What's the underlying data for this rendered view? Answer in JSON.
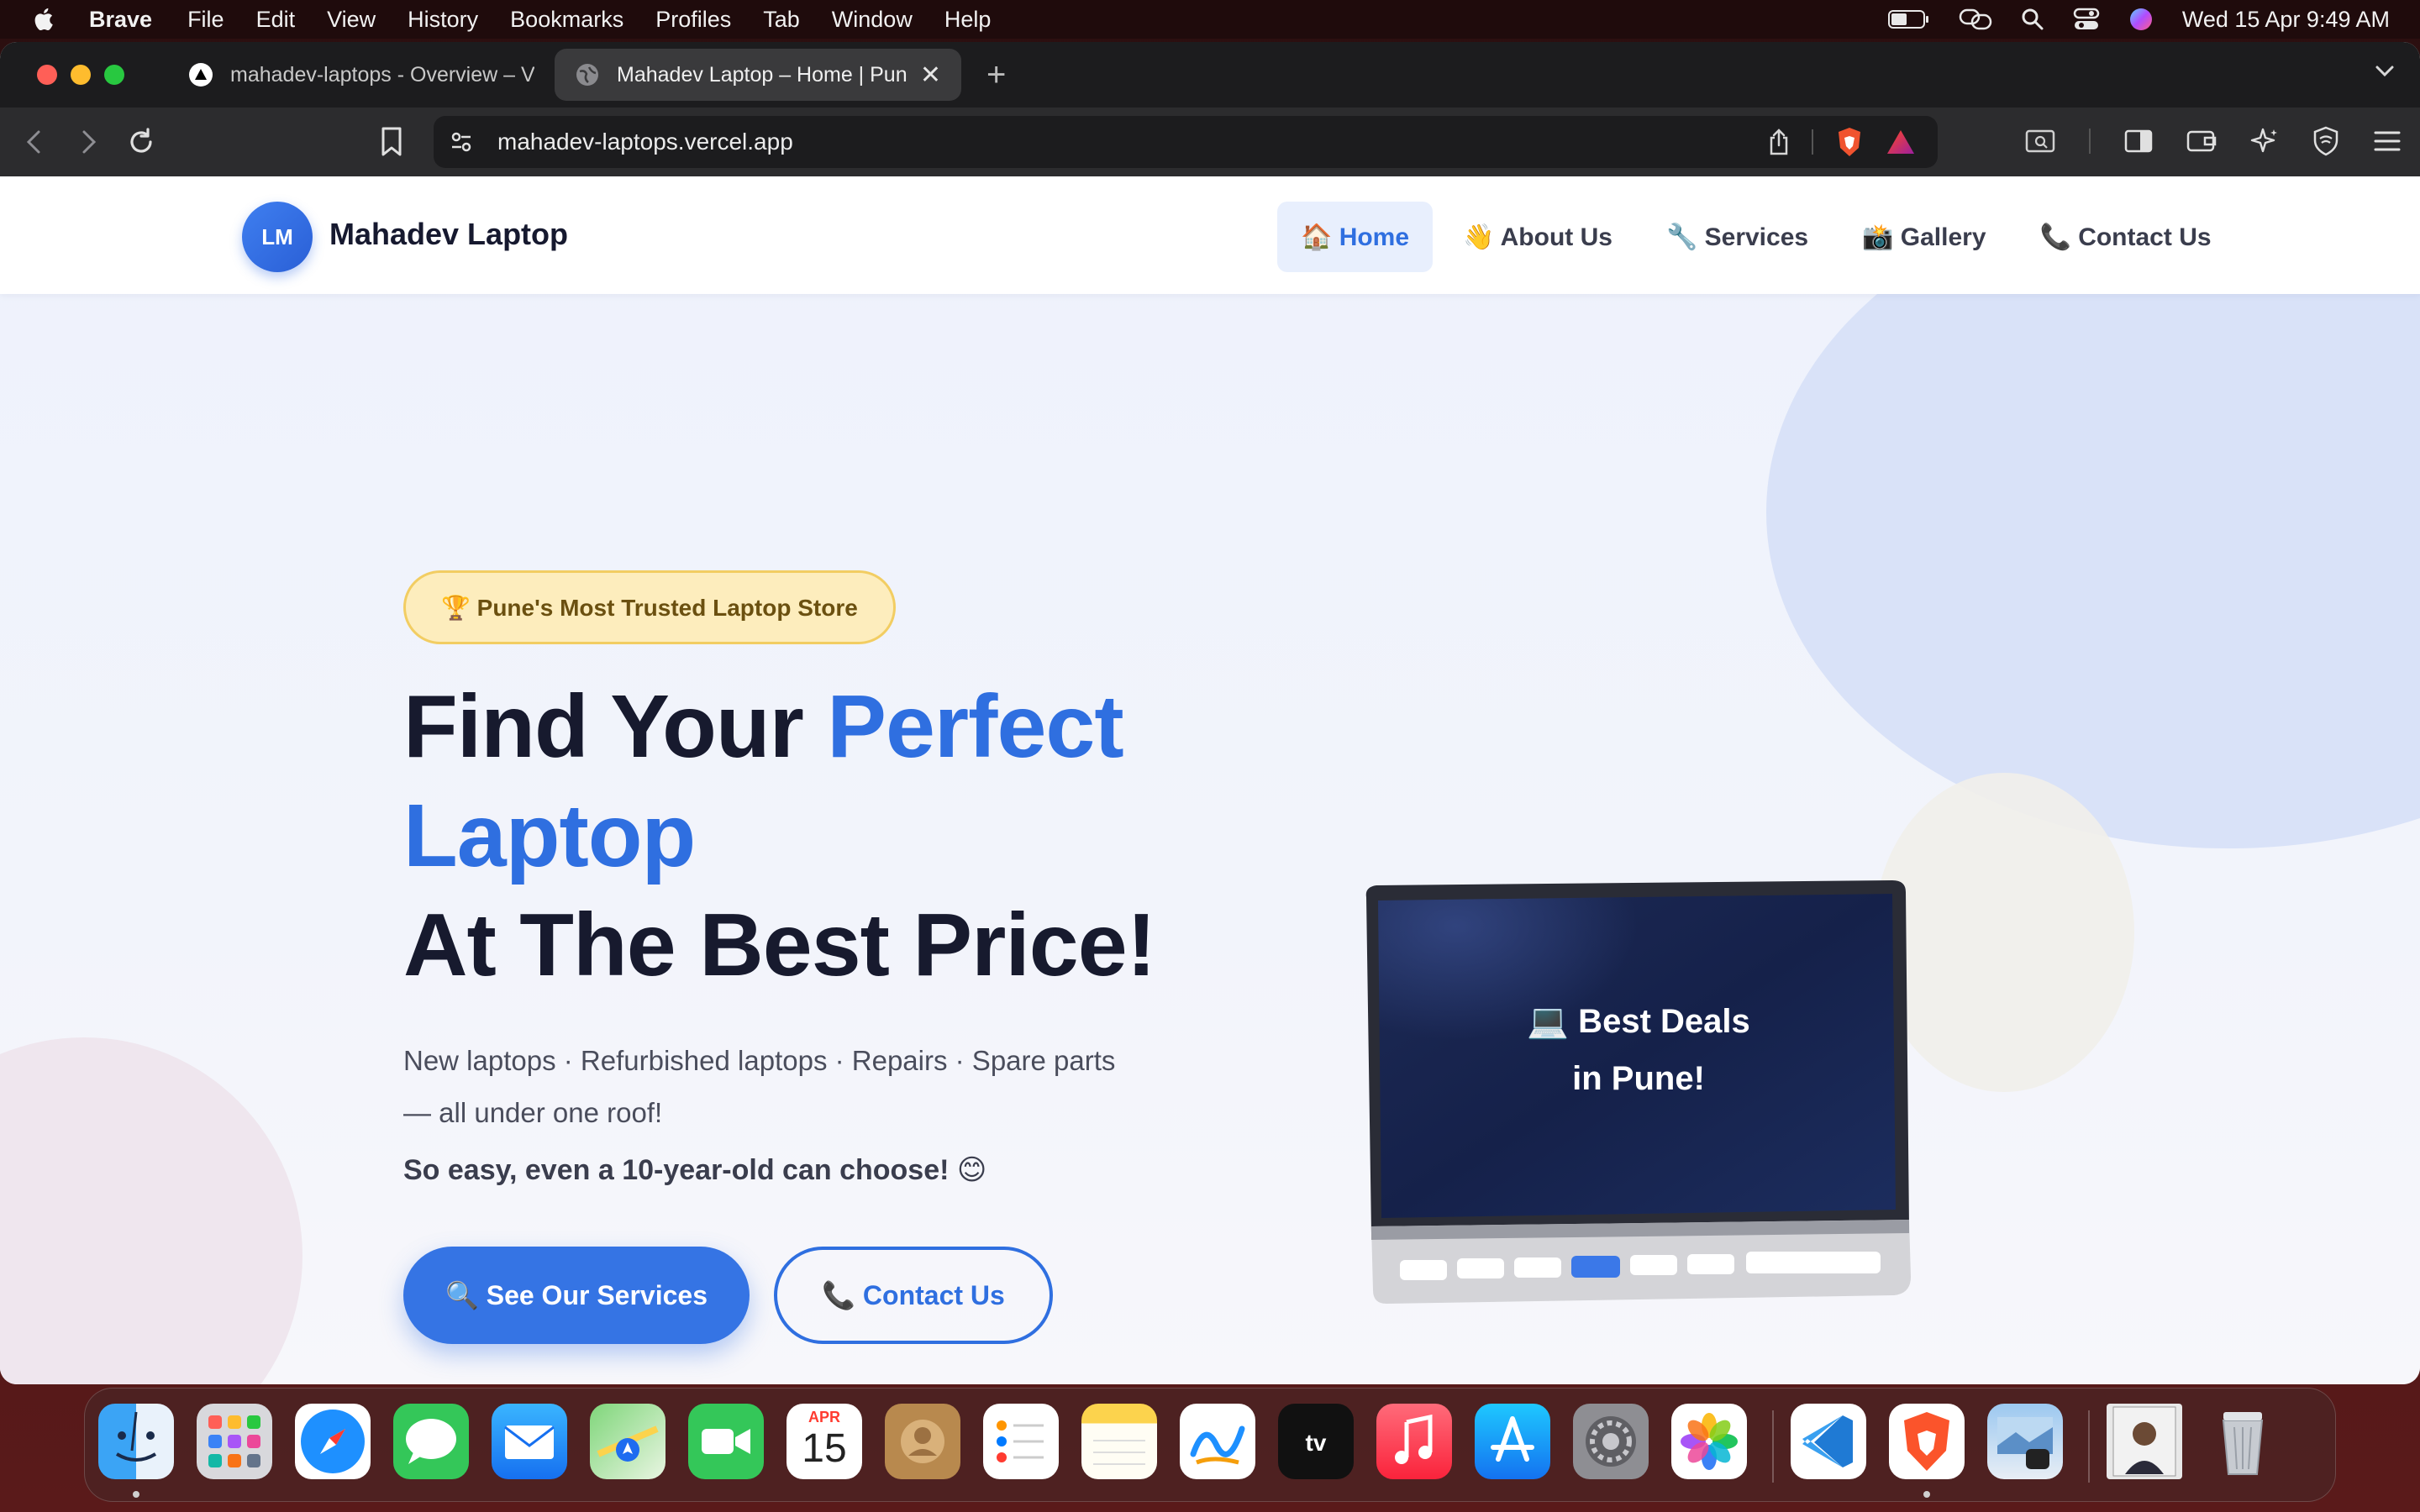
{
  "menubar": {
    "app_name": "Brave",
    "menus": [
      "File",
      "Edit",
      "View",
      "History",
      "Bookmarks",
      "Profiles",
      "Tab",
      "Window",
      "Help"
    ],
    "clock": "Wed 15 Apr  9:49 AM"
  },
  "browser": {
    "tabs": [
      {
        "title": "mahadev-laptops - Overview – Ver",
        "active": false
      },
      {
        "title": "Mahadev Laptop – Home | Pun",
        "active": true
      }
    ],
    "url": "mahadev-laptops.vercel.app"
  },
  "site": {
    "logo_initials": "LM",
    "brand": "Mahadev Laptop",
    "nav": [
      {
        "label": "🏠 Home",
        "active": true
      },
      {
        "label": "👋 About Us",
        "active": false
      },
      {
        "label": "🔧 Services",
        "active": false
      },
      {
        "label": "📸 Gallery",
        "active": false
      },
      {
        "label": "📞 Contact Us",
        "active": false
      }
    ],
    "hero": {
      "badge": "🏆 Pune's Most Trusted Laptop Store",
      "title_line1": "Find Your ",
      "title_highlight_1": "Perfect",
      "title_highlight_2": "Laptop",
      "title_line3": "At The Best Price!",
      "subtitle_line1": "New laptops · Refurbished laptops · Repairs · Spare parts",
      "subtitle_line2": "— all under one roof!",
      "subtitle_bold": "So easy, even a 10-year-old can choose! 😊",
      "primary_cta": "🔍 See Our Services",
      "secondary_cta": "📞 Contact Us",
      "screen_line1": "💻 Best Deals",
      "screen_line2": "in Pune!"
    },
    "colors": {
      "accent": "#2f6fe0",
      "badge_bg": "#fdedbd",
      "heading": "#171a2e"
    }
  },
  "calendar_icon": {
    "month": "APR",
    "day": "15"
  },
  "dock": {
    "apps": [
      "finder-icon",
      "launchpad-icon",
      "safari-icon",
      "messages-icon",
      "mail-icon",
      "maps-icon",
      "facetime-icon",
      "calendar-icon",
      "contacts-icon",
      "reminders-icon",
      "notes-icon",
      "freeform-icon",
      "apple-tv-icon",
      "music-icon",
      "app-store-icon",
      "system-settings-icon",
      "photos-icon",
      "vscode-icon",
      "brave-icon",
      "preview-icon",
      "profile-photo-icon",
      "trash-icon"
    ]
  }
}
